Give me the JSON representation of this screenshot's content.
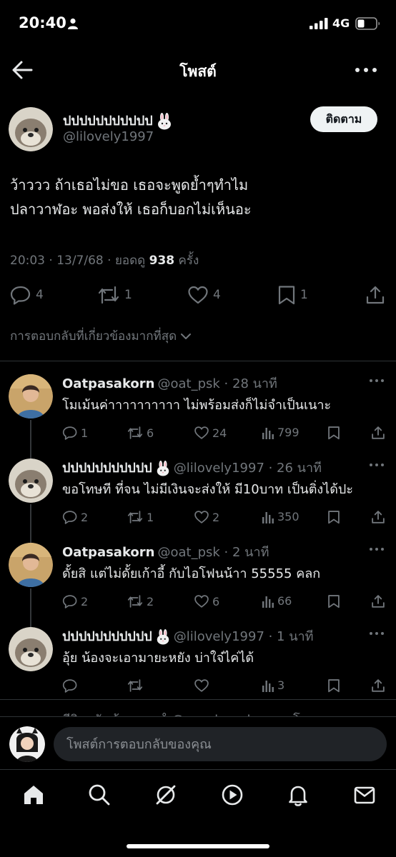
{
  "status_bar": {
    "time": "20:40",
    "network": "4G"
  },
  "nav": {
    "title": "โพสต์"
  },
  "post": {
    "author_name": "ปปปปปปปปปปป",
    "author_handle": "@lilovely1997",
    "follow_label": "ติดตาม",
    "body": "ว้าววว ถ้าเธอไม่ขอ เธอจะพูดย้ำๆทำไม\nปลาวาฬอะ พอส่งให้ เธอก็บอกไม่เห็นอะ",
    "meta_prefix": "20:03 · 13/7/68 · ยอดดู ",
    "views": "938",
    "meta_suffix": " ครั้ง",
    "replies": "4",
    "reposts": "1",
    "likes": "4",
    "bookmarks": "1",
    "sort_label": "การตอบกลับที่เกี่ยวข้องมากที่สุด"
  },
  "replies": [
    {
      "name": "Oatpasakorn",
      "meta": "@oat_psk · 28 นาที",
      "text": "โมเม้นค่าาาาาาาาาา ไม่พร้อมส่งก็ไม่จำเป็นเนาะ",
      "replies": "1",
      "reposts": "6",
      "likes": "24",
      "views": "799"
    },
    {
      "name": "ปปปปปปปปปปป",
      "meta": "@lilovely1997 · 26 นาที",
      "text": "ขอโทษที ที่จน ไม่มีเงินจะส่งให้ มี10บาท เป็นติ่งได้ปะ",
      "replies": "2",
      "reposts": "1",
      "likes": "2",
      "views": "350"
    },
    {
      "name": "Oatpasakorn",
      "meta": "@oat_psk · 2 นาที",
      "text": "ดั้ยสิ แต่ไม่ดั้ยเก้าอี้ กับไอโฟนน้าา 55555 คลก",
      "replies": "2",
      "reposts": "2",
      "likes": "6",
      "views": "66"
    },
    {
      "name": "ปปปปปปปปปปป",
      "meta": "@lilovely1997 · 1 นาที",
      "text": "อุ้ย น้องจะเอามายะหยัง บ่าใจ๋ไค่ได้",
      "replies": "",
      "reposts": "",
      "likes": "",
      "views": "3"
    }
  ],
  "partial_reply": {
    "text": "นีริวลนันช้อมรรย ˚ @pacchanplease · โพแบเอา"
  },
  "compose": {
    "placeholder": "โพสต์การตอบกลับของคุณ"
  },
  "colors": {
    "background": "#000000",
    "text": "#e7e9ea",
    "secondary": "#71767b",
    "divider": "#2f3336"
  }
}
